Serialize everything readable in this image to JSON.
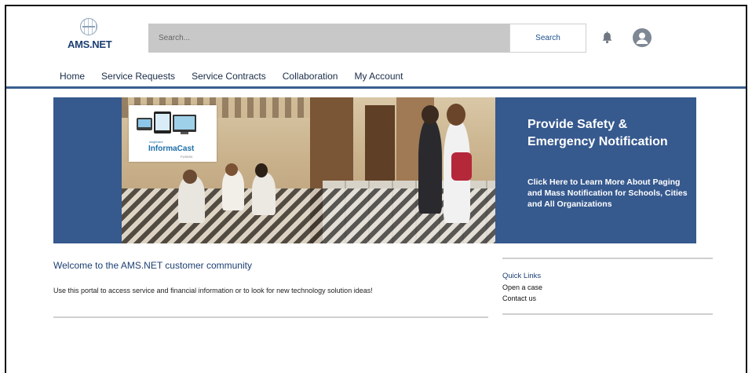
{
  "header": {
    "logo_text": "AMS.NET",
    "search": {
      "placeholder": "Search...",
      "button_label": "Search"
    },
    "icons": {
      "notifications": "bell-icon",
      "profile": "user-avatar-icon"
    }
  },
  "nav": {
    "items": [
      {
        "label": "Home"
      },
      {
        "label": "Service Requests"
      },
      {
        "label": "Service Contracts"
      },
      {
        "label": "Collaboration"
      },
      {
        "label": "My Account"
      }
    ]
  },
  "banner": {
    "heading": "Provide Safety & Emergency Notification",
    "subheading": "Click Here to Learn More About Paging and Mass Notification for Schools, Cities and All Organizations",
    "product_card": {
      "small_brand": "singlewire",
      "brand": "InformaCast",
      "sub": "FUSION"
    },
    "colors": {
      "background": "#36598e"
    }
  },
  "welcome": {
    "title": "Welcome to the AMS.NET customer community",
    "text": "Use this portal to access service and financial information or to look for new technology solution ideas!"
  },
  "quick_links": {
    "title": "Quick Links",
    "items": [
      {
        "label": "Open a case"
      },
      {
        "label": "Contact us"
      }
    ]
  },
  "colors": {
    "brand": "#1d3f73",
    "nav_rule": "#3a5f8f",
    "search_bg": "#c8c8c8"
  }
}
